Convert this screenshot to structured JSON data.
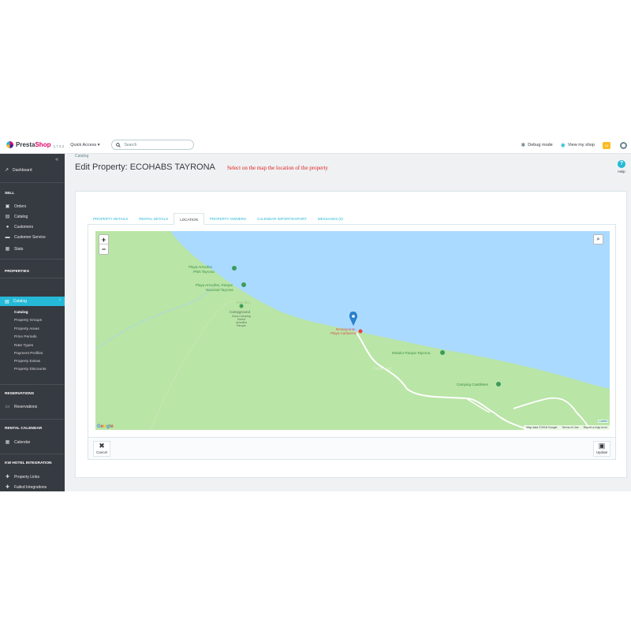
{
  "header": {
    "logo_prefix": "Presta",
    "logo_suffix": "Shop",
    "version": "1.7.4.2",
    "quick_access": "Quick Access ▾",
    "search_placeholder": "Search",
    "debug_mode": "Debug mode",
    "view_shop": "View my shop",
    "notif_count": "10"
  },
  "sidebar": {
    "dashboard": "Dashboard",
    "sections": {
      "sell": "SELL",
      "properties": "PROPERTIES",
      "reservations": "RESERVATIONS",
      "rental_calendar": "RENTAL CALENDAR",
      "kw": "KW HOTEL INTEGRATION"
    },
    "sell_items": [
      "Orders",
      "Catalog",
      "Customers",
      "Customer Service",
      "Stats"
    ],
    "catalog": "Catalog",
    "catalog_sub": [
      "Catalog",
      "Property Groups",
      "Property Areas",
      "Price Periods",
      "Rate Types",
      "Payment Profiles",
      "Property Extras",
      "Property Discounts"
    ],
    "reservations_item": "Reservations",
    "calendar_item": "Calendar",
    "kw_items": [
      "Property Links",
      "Failed Integrations"
    ]
  },
  "breadcrumb": "Catalog",
  "page_title": "Edit Property: ECOHABS TAYRONA",
  "note": "Select on the map the location of the property",
  "help": "Help",
  "tabs": [
    "PROPERTY DETAILS",
    "RENTAL DETAILS",
    "LOCATION",
    "PROPERTY OWNERS",
    "CALENDAR IMPORT/EXPORT",
    "MESSAGES (0)"
  ],
  "active_tab": "LOCATION",
  "map": {
    "labels": {
      "arrecifes_hab": "Playa Arrecifes",
      "arrecifes_hab2": "PNN Tayrona",
      "arrecifes_parque": "Playa Arrecifes, Parque",
      "arrecifes_parque2": "Nacional Tayrona",
      "arrecifes_faint": "Arrecifes",
      "campground": "Campground",
      "campground_sub1": "Zona Camping",
      "campground_sub2": "Sector",
      "campground_sub3": "Arrecifes",
      "campground_sub4": "Parque",
      "restaurant": "Restaurante",
      "restaurant2": "Playa Cañaveral",
      "mirador": "Mirador Parque Tayrona",
      "camping": "Camping Castilletes",
      "road": "Cañaveral"
    },
    "zoom_in": "+",
    "zoom_out": "−",
    "attribution": [
      "Map data ©2018 Google",
      "Terms of Use",
      "Report a map error"
    ],
    "leaflet": "Leaflet",
    "google": [
      "G",
      "o",
      "o",
      "g",
      "l",
      "e"
    ]
  },
  "buttons": {
    "cancel": "Cancel",
    "update": "Update"
  }
}
